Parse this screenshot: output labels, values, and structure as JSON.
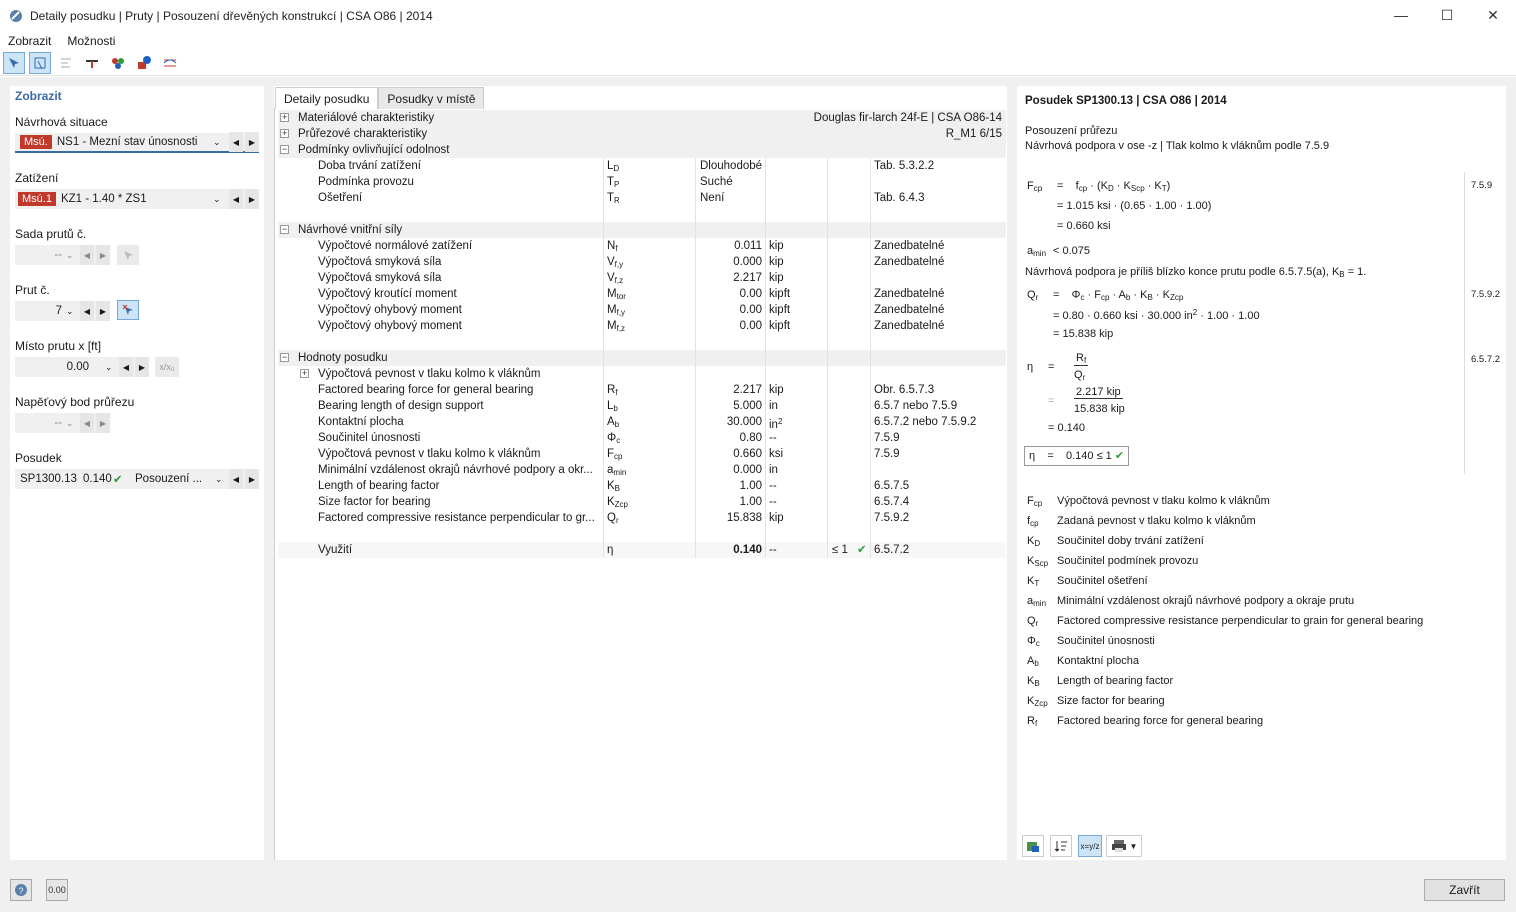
{
  "window": {
    "title": "Detaily posudku | Pruty | Posouzení dřevěných konstrukcí | CSA O86 | 2014",
    "min": "—",
    "max": "☐",
    "close": "✕"
  },
  "menu": [
    "Zobrazit",
    "Možnosti"
  ],
  "left": {
    "header": "Zobrazit",
    "situation_label": "Návrhová situace",
    "situation_badge": "Msú.",
    "situation_value": "NS1 - Mezní stav únosnosti",
    "load_label": "Zatížení",
    "load_badge": "Msú.1",
    "load_value": "KZ1 - 1.40 * ZS1",
    "set_label": "Sada prutů č.",
    "set_value": "--",
    "member_label": "Prut č.",
    "member_value": "7",
    "location_label": "Místo prutu x [ft]",
    "location_value": "0.00",
    "xbtn": "x/x₀",
    "stress_label": "Napěťový bod průřezu",
    "stress_value": "--",
    "check_label": "Posudek",
    "check_id": "SP1300.13",
    "check_ratio": "0.140",
    "check_desc": "Posouzení ..."
  },
  "tabs": [
    "Detaily posudku",
    "Posudky v místě"
  ],
  "sections": {
    "mat": {
      "name": "Materiálové charakteristiky",
      "value": "Douglas fir-larch 24f-E | CSA O86-14"
    },
    "cs": {
      "name": "Průřezové charakteristiky",
      "value": "R_M1 6/15"
    },
    "cond": {
      "name": "Podmínky ovlivňující odolnost",
      "rows": [
        {
          "n": "Doba trvání zatížení",
          "s": "LD",
          "v": "Dlouhodobé",
          "r": "Tab. 5.3.2.2"
        },
        {
          "n": "Podmínka provozu",
          "s": "TP",
          "v": "Suché",
          "r": ""
        },
        {
          "n": "Ošetření",
          "s": "TR",
          "v": "Není",
          "r": "Tab. 6.4.3"
        }
      ]
    },
    "forces": {
      "name": "Návrhové vnitřní síly",
      "rows": [
        {
          "n": "Výpočtové normálové zatížení",
          "s": "Nf",
          "v": "0.011",
          "u": "kip",
          "r": "Zanedbatelné"
        },
        {
          "n": "Výpočtová smyková síla",
          "s": "Vf,y",
          "v": "0.000",
          "u": "kip",
          "r": "Zanedbatelné"
        },
        {
          "n": "Výpočtová smyková síla",
          "s": "Vf,z",
          "v": "2.217",
          "u": "kip",
          "r": ""
        },
        {
          "n": "Výpočtový kroutící moment",
          "s": "Mtor",
          "v": "0.00",
          "u": "kipft",
          "r": "Zanedbatelné"
        },
        {
          "n": "Výpočtový ohybový moment",
          "s": "Mf,y",
          "v": "0.00",
          "u": "kipft",
          "r": "Zanedbatelné"
        },
        {
          "n": "Výpočtový ohybový moment",
          "s": "Mf,z",
          "v": "0.00",
          "u": "kipft",
          "r": "Zanedbatelné"
        }
      ]
    },
    "vals": {
      "name": "Hodnoty posudku",
      "sub": "Výpočtová pevnost v tlaku kolmo k vláknům",
      "rows": [
        {
          "n": "Factored bearing force for general bearing",
          "s": "Rf",
          "v": "2.217",
          "u": "kip",
          "r": "Obr. 6.5.7.3"
        },
        {
          "n": "Bearing length of design support",
          "s": "Lb",
          "v": "5.000",
          "u": "in",
          "r": "6.5.7 nebo 7.5.9"
        },
        {
          "n": "Kontaktní plocha",
          "s": "Ab",
          "v": "30.000",
          "u": "in²",
          "r": "6.5.7.2 nebo 7.5.9.2"
        },
        {
          "n": "Součinitel únosnosti",
          "s": "Φc",
          "v": "0.80",
          "u": "--",
          "r": "7.5.9"
        },
        {
          "n": "Výpočtová pevnost v tlaku kolmo k vláknům",
          "s": "Fcp",
          "v": "0.660",
          "u": "ksi",
          "r": "7.5.9"
        },
        {
          "n": "Minimální vzdálenost okrajů návrhové podpory a okr...",
          "s": "amin",
          "v": "0.000",
          "u": "in",
          "r": ""
        },
        {
          "n": "Length of bearing factor",
          "s": "KB",
          "v": "1.00",
          "u": "--",
          "r": "6.5.7.5"
        },
        {
          "n": "Size factor for bearing",
          "s": "KZcp",
          "v": "1.00",
          "u": "--",
          "r": "6.5.7.4"
        },
        {
          "n": "Factored compressive resistance perpendicular to gr...",
          "s": "Qr",
          "v": "15.838",
          "u": "kip",
          "r": "7.5.9.2"
        }
      ],
      "util": {
        "n": "Využití",
        "s": "η",
        "v": "0.140",
        "u": "--",
        "l": "≤ 1",
        "r": "6.5.7.2"
      }
    }
  },
  "right": {
    "title": "Posudek SP1300.13 | CSA O86 | 2014",
    "sub1": "Posouzení průřezu",
    "sub2": "Návrhová podpora v ose -z | Tlak kolmo k vláknům podle 7.5.9",
    "ref1": "7.5.9",
    "ref2": "7.5.9.2",
    "ref3": "6.5.7.2",
    "amin": "< 0.075",
    "note": "Návrhová podpora je příliš blízko konce prutu podle 6.5.7.5(a), K",
    "note_tail": " = 1.",
    "f1": "= 1.015 ksi · (0.65 · 1.00 · 1.00)",
    "f2": "= 0.660 ksi",
    "q1": "= 0.80 · 0.660 ksi · 30.000 in",
    "q1b": " · 1.00 · 1.00",
    "q2": "= 15.838 kip",
    "e_num": "2.217 kip",
    "e_den": "15.838 kip",
    "e_res": "= 0.140",
    "final": "0.140 ≤ 1",
    "legend": [
      {
        "s": "F",
        "b": "cp",
        "t": "Výpočtová pevnost v tlaku kolmo k vláknům"
      },
      {
        "s": "f",
        "b": "cp",
        "t": "Zadaná pevnost v tlaku kolmo k vláknům"
      },
      {
        "s": "K",
        "b": "D",
        "t": "Součinitel doby trvání zatížení"
      },
      {
        "s": "K",
        "b": "Scp",
        "t": "Součinitel podmínek provozu"
      },
      {
        "s": "K",
        "b": "T",
        "t": "Součinitel ošetření"
      },
      {
        "s": "a",
        "b": "min",
        "t": "Minimální vzdálenost okrajů návrhové podpory a okraje prutu"
      },
      {
        "s": "Q",
        "b": "r",
        "t": "Factored compressive resistance perpendicular to grain for general bearing"
      },
      {
        "s": "Φ",
        "b": "c",
        "t": "Součinitel únosnosti"
      },
      {
        "s": "A",
        "b": "b",
        "t": "Kontaktní plocha"
      },
      {
        "s": "K",
        "b": "B",
        "t": "Length of bearing factor"
      },
      {
        "s": "K",
        "b": "Zcp",
        "t": "Size factor for bearing"
      },
      {
        "s": "R",
        "b": "f",
        "t": "Factored bearing force for general bearing"
      }
    ]
  },
  "footer": {
    "close": "Zavřít",
    "units": "0.00"
  }
}
